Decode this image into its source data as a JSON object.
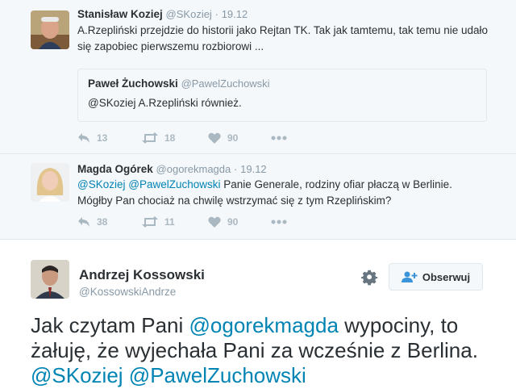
{
  "tweet1": {
    "name": "Stanisław Koziej",
    "handle": "@SKoziej",
    "separator": "·",
    "date": "19.12",
    "text": "A.Rzepliński przejdzie do historii jako Rejtan TK. Tak jak tamtemu, tak temu nie udało się zapobiec pierwszemu rozbiorowi ...",
    "quote": {
      "name": "Paweł Żuchowski",
      "handle": "@PawelZuchowski",
      "text": "@SKoziej A.Rzepliński również."
    },
    "replies": "13",
    "retweets": "18",
    "likes": "90"
  },
  "tweet2": {
    "name": "Magda Ogórek",
    "handle": "@ogorekmagda",
    "separator": "·",
    "date": "19.12",
    "mention1": "@SKoziej",
    "mention2": "@PawelZuchowski",
    "text_line1": " Panie Generale, rodziny ofiar płaczą w Berlinie.",
    "text_line2": "Mógłby Pan chociaż na chwilę wstrzymać się z tym Rzeplińskim?",
    "replies": "38",
    "retweets": "11",
    "likes": "90"
  },
  "main_tweet": {
    "name": "Andrzej Kossowski",
    "handle": "@KossowskiAndrze",
    "follow_label": "Obserwuj",
    "text_part1": "Jak czytam Pani ",
    "mention1": "@ogorekmagda",
    "text_part2": " wypociny, to żałuję, że wyjechała Pani za wcześnie z Berlina. ",
    "mention2": "@SKoziej",
    "mention3": "@PawelZuchowski"
  },
  "colors": {
    "accent": "#0084b4",
    "muted": "#8899a6",
    "action": "#aab8c2",
    "background_thread": "#f5f8fa"
  }
}
